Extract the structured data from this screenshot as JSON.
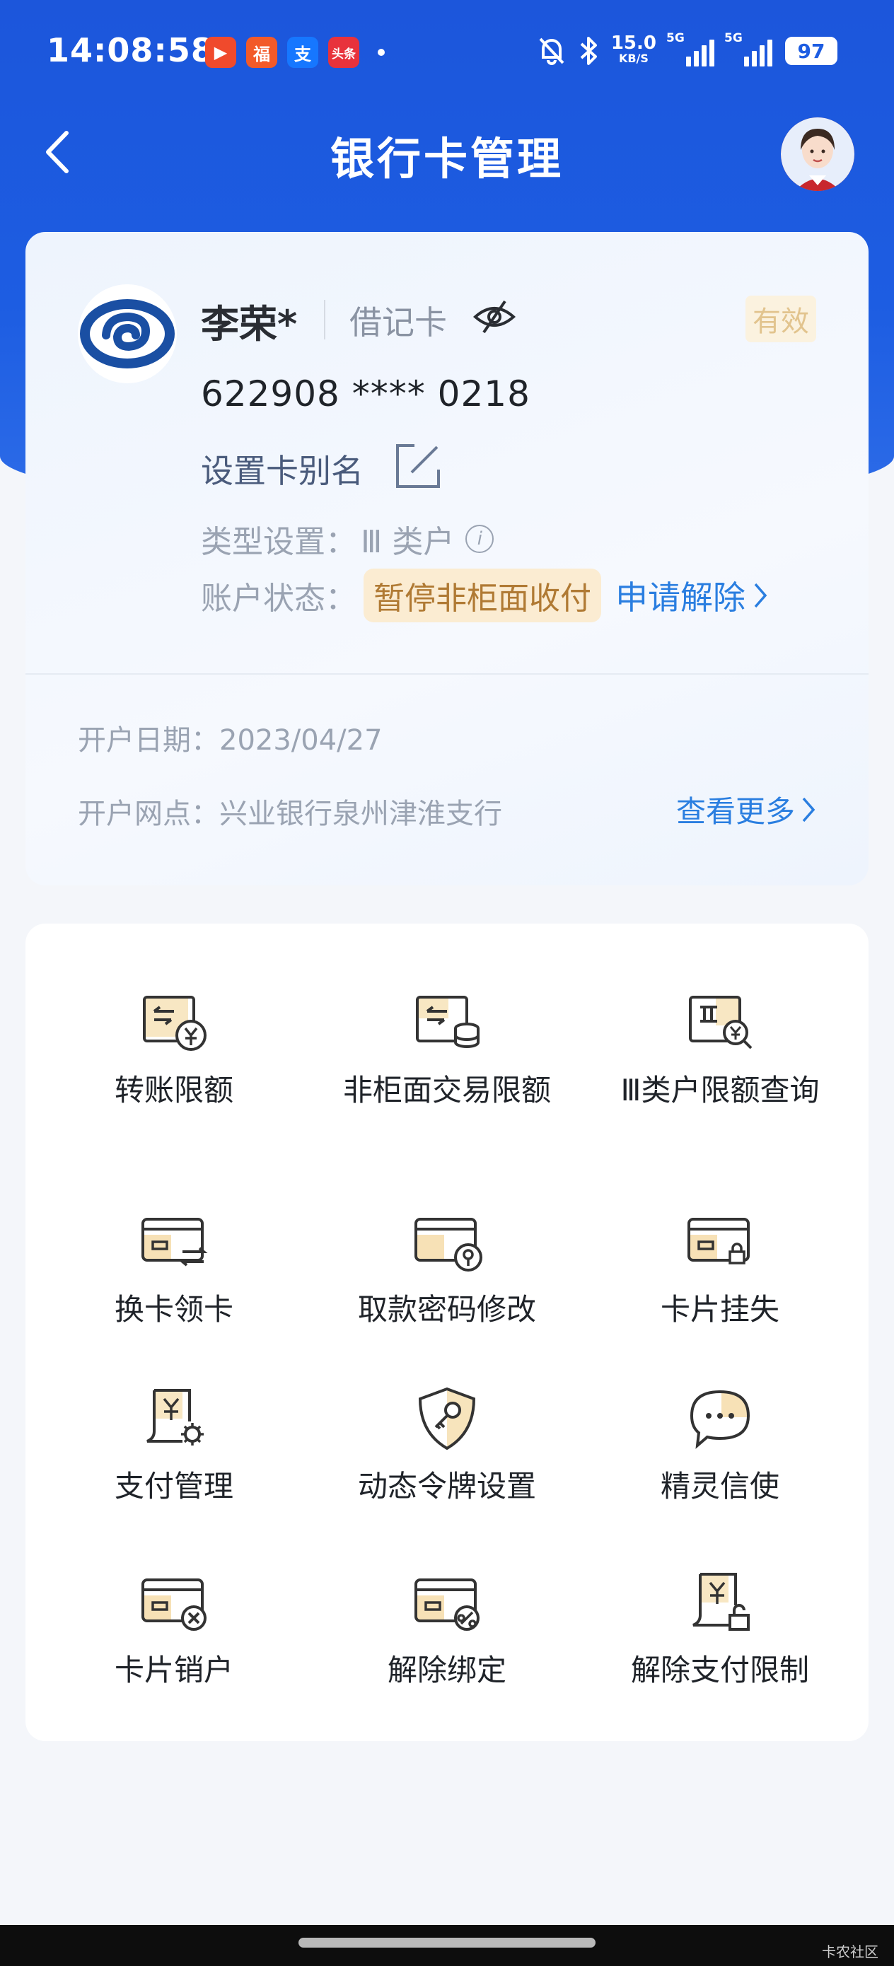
{
  "status_bar": {
    "time": "14:08:58",
    "app_icons": [
      {
        "name": "video-app-icon",
        "glyph": "▶",
        "color": "#f04a2c"
      },
      {
        "name": "gift-app-icon",
        "glyph": "福",
        "color": "#f25a29"
      },
      {
        "name": "alipay-icon",
        "glyph": "支",
        "color": "#1677ff"
      },
      {
        "name": "toutiao-icon",
        "glyph": "头条",
        "color": "#e8323c"
      }
    ],
    "net_speed_value": "15.0",
    "net_speed_unit": "KB/S",
    "signal_label_1": "5G",
    "signal_label_2": "5G",
    "battery": "97"
  },
  "header": {
    "title": "银行卡管理"
  },
  "card": {
    "holder_name": "李荣*",
    "card_type": "借记卡",
    "validity": "有效",
    "card_number": "622908 **** 0218",
    "alias_label": "设置卡别名",
    "type_setting_label": "类型设置：",
    "type_setting_value": "Ⅲ 类户",
    "account_status_label": "账户状态：",
    "account_status_value": "暂停非柜面收付",
    "unlock_link": "申请解除",
    "open_date_label": "开户日期：",
    "open_date_value": "2023/04/27",
    "open_branch_label": "开户网点：",
    "open_branch_value": "兴业银行泉州津淮支行",
    "more_link": "查看更多"
  },
  "grid": {
    "items": [
      {
        "label": "转账限额",
        "icon": "transfer-limit-icon"
      },
      {
        "label": "非柜面交易限额",
        "icon": "non-counter-limit-icon"
      },
      {
        "label": "Ⅲ类户限额查询",
        "icon": "class3-limit-query-icon"
      },
      {
        "label": "换卡领卡",
        "icon": "card-replace-icon"
      },
      {
        "label": "取款密码修改",
        "icon": "pin-change-icon"
      },
      {
        "label": "卡片挂失",
        "icon": "card-lost-icon"
      },
      {
        "label": "支付管理",
        "icon": "payment-settings-icon"
      },
      {
        "label": "动态令牌设置",
        "icon": "dynamic-token-icon"
      },
      {
        "label": "精灵信使",
        "icon": "messenger-icon"
      },
      {
        "label": "卡片销户",
        "icon": "card-close-icon"
      },
      {
        "label": "解除绑定",
        "icon": "unbind-icon"
      },
      {
        "label": "解除支付限制",
        "icon": "payment-unlock-icon"
      }
    ]
  },
  "watermark": "卡农社区",
  "colors": {
    "brand_blue": "#1d5de2",
    "link_blue": "#2a7ee0",
    "status_pill_bg": "#fbecd2",
    "status_pill_text": "#b07a34",
    "icon_gold": "#f0c97a"
  }
}
